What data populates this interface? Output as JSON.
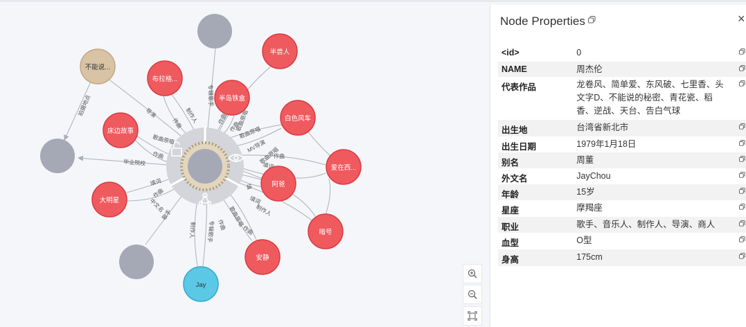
{
  "panel": {
    "title": "Node Properties",
    "close": "×",
    "properties": [
      {
        "key": "<id>",
        "value": "0"
      },
      {
        "key": "NAME",
        "value": "周杰伦"
      },
      {
        "key": "代表作品",
        "value": "龙卷风、简单爱、东风破、七里香、头文字D、不能说的秘密、青花瓷、稻香、逆战、天台、告白气球"
      },
      {
        "key": "出生地",
        "value": "台湾省新北市"
      },
      {
        "key": "出生日期",
        "value": "1979年1月18日"
      },
      {
        "key": "别名",
        "value": "周董"
      },
      {
        "key": "外文名",
        "value": "JayChou"
      },
      {
        "key": "年龄",
        "value": "15岁"
      },
      {
        "key": "星座",
        "value": "摩羯座"
      },
      {
        "key": "职业",
        "value": "歌手、音乐人、制作人、导演、商人"
      },
      {
        "key": "血型",
        "value": "O型"
      },
      {
        "key": "身高",
        "value": "175cm"
      }
    ]
  },
  "graph": {
    "nodes": {
      "buneng": "不能说...",
      "bulage": "布拉格...",
      "banshan": "半兽人",
      "bandao": "半岛铁盒",
      "baise": "白色风车",
      "aizai": "爱在西...",
      "abao": "阿爸",
      "anhao": "暗号",
      "anjing": "安静",
      "jay": "Jay",
      "damingxing": "大明星",
      "chuangbian": "床边故事"
    },
    "edges": {
      "paishe": "拍摄地点",
      "daoyan": "导演",
      "zuoqu1": "作曲",
      "zuoqu2": "作曲",
      "zhizuoren1": "制作人",
      "zhuanjige1": "专辑歌手",
      "zuoqu3": "作曲",
      "geqiyuanchang": "歌曲原唱",
      "geqiyuanchang2": "歌曲原唱",
      "mvdaoyan": "MV导演",
      "zuoqu4": "作曲",
      "zuoqu5": "作曲",
      "geqiyuanchang3": "歌曲原唱",
      "geqiyuanchang4": "歌曲原唱",
      "biye": "毕业院校",
      "zuoci": "填词",
      "zuoqu6": "作曲",
      "zhongwen": "中文名",
      "geshou": "歌手",
      "zhizuoren2": "制作人",
      "zhuanjige2": "专辑歌手",
      "zuoqu7": "作曲",
      "geqiyuanchang5": "歌曲原唱",
      "zhizuoren3": "制作人",
      "zuoqu8": "作曲",
      "zuoci2": "填词",
      "tian": "填",
      "zuoci3": "填词"
    }
  },
  "zoom": {
    "in": "zoom in",
    "out": "zoom out",
    "fit": "fit"
  },
  "colors": {
    "red_node": "#ef5a5f",
    "red_border": "#d93a3f",
    "gray_node": "#a5a9b6",
    "tan_node": "#d9c3a5",
    "tan_border": "#c2a682",
    "blue_node": "#5bc8e6",
    "blue_border": "#35a8cc",
    "ring": "#d3d5da",
    "edge": "#aab0b8"
  }
}
